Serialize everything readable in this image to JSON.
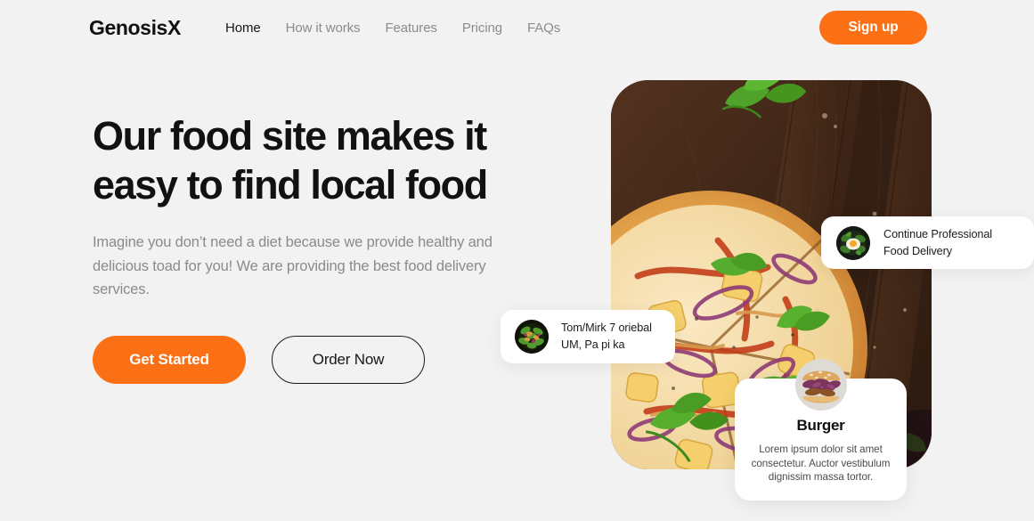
{
  "brand": {
    "name": "GenosisX"
  },
  "nav": {
    "items": [
      {
        "label": "Home",
        "active": true
      },
      {
        "label": "How it works",
        "active": false
      },
      {
        "label": "Features",
        "active": false
      },
      {
        "label": "Pricing",
        "active": false
      },
      {
        "label": "FAQs",
        "active": false
      }
    ],
    "signup_label": "Sign up"
  },
  "hero": {
    "title": "Our food site makes it\neasy to find local food",
    "subtitle": "Imagine you don’t need a diet because we provide healthy and delicious toad for you! We are providing the best food delivery services.",
    "primary_cta": "Get Started",
    "secondary_cta": "Order Now",
    "image_alt": "pizza-on-wooden-board"
  },
  "cards": {
    "continue": {
      "line1": "Continue Professional",
      "line2": "Food Delivery",
      "thumb_alt": "egg-bowl-thumbnail"
    },
    "tommirk": {
      "line1": "Tom/Mirk 7 oriebal",
      "line2": "UM, Pa pi ka",
      "thumb_alt": "salad-bowl-thumbnail"
    },
    "burger": {
      "title": "Burger",
      "description": "Lorem ipsum dolor sit amet consectetur. Auctor vestibulum dignissim massa tortor.",
      "avatar_alt": "burger-avatar"
    }
  },
  "colors": {
    "background": "#f2f2f2",
    "accent": "#fb6f15",
    "text_dark": "#111113",
    "text_muted": "#8a8a8f",
    "card_bg": "#ffffff"
  }
}
